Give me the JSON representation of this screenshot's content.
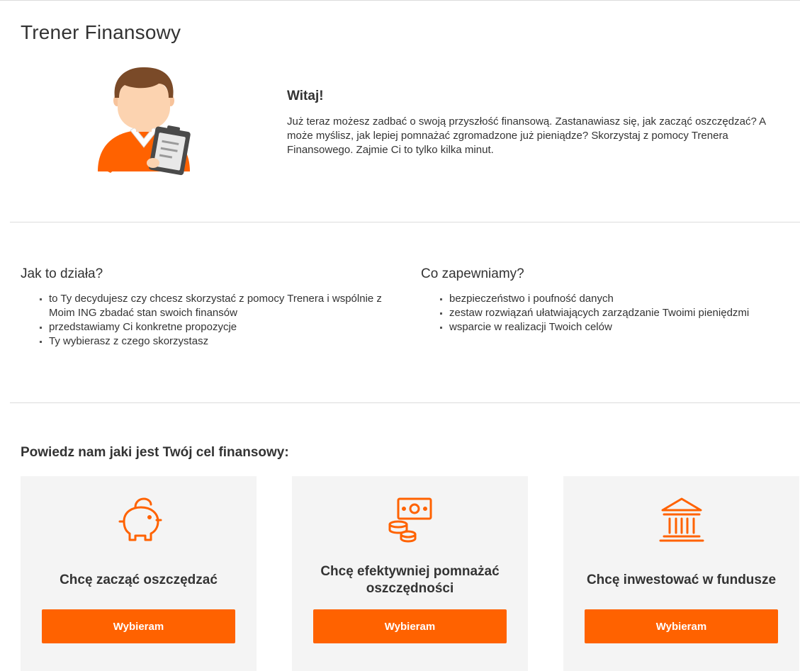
{
  "page": {
    "title": "Trener Finansowy"
  },
  "intro": {
    "heading": "Witaj!",
    "text": "Już teraz możesz zadbać o swoją przyszłość finansową. Zastanawiasz się, jak zacząć oszczędzać? A może myślisz, jak lepiej pomnażać zgromadzone już pieniądze? Skorzystaj z pomocy Trenera Finansowego. Zajmie Ci to tylko kilka minut.",
    "illustration_icon": "advisor-with-clipboard-icon"
  },
  "how": {
    "heading": "Jak to działa?",
    "items": [
      "to Ty decydujesz czy chcesz skorzystać z pomocy Trenera i wspólnie z Moim ING zbadać stan swoich finansów",
      "przedstawiamy Ci konkretne propozycje",
      "Ty wybierasz z czego skorzystasz"
    ]
  },
  "offer": {
    "heading": "Co zapewniamy?",
    "items": [
      "bezpieczeństwo i poufność danych",
      "zestaw rozwiązań ułatwiających zarządzanie Twoimi pieniędzmi",
      "wsparcie w realizacji Twoich celów"
    ]
  },
  "goals": {
    "heading": "Powiedz nam jaki jest Twój cel finansowy:",
    "cards": [
      {
        "icon": "piggy-bank-icon",
        "title": "Chcę zacząć oszczędzać",
        "button": "Wybieram"
      },
      {
        "icon": "money-coins-icon",
        "title": "Chcę efektywniej pomnażać oszczędności",
        "button": "Wybieram"
      },
      {
        "icon": "bank-building-icon",
        "title": "Chcę inwestować w fundusze",
        "button": "Wybieram"
      }
    ]
  },
  "colors": {
    "accent": "#ff6200",
    "card_background": "#f4f4f4",
    "divider": "#dcdcdc",
    "text": "#333333"
  }
}
